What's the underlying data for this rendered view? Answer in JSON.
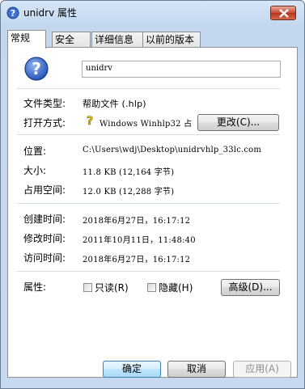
{
  "window": {
    "title": "unidrv 属性"
  },
  "tabs": [
    {
      "label": "常规"
    },
    {
      "label": "安全"
    },
    {
      "label": "详细信息"
    },
    {
      "label": "以前的版本"
    }
  ],
  "general": {
    "file_name": "unidrv",
    "file_type": {
      "label": "文件类型:",
      "value": "帮助文件 (.hlp)"
    },
    "open_with": {
      "label": "打开方式:",
      "value": "Windows Winhlp32 占",
      "change_button": "更改(C)..."
    },
    "location": {
      "label": "位置:",
      "value": "C:\\Users\\wdj\\Desktop\\unidrvhlp_33lc.com"
    },
    "size": {
      "label": "大小:",
      "value": "11.8 KB (12,164 字节)"
    },
    "size_on_disk": {
      "label": "占用空间:",
      "value": "12.0 KB (12,288 字节)"
    },
    "created": {
      "label": "创建时间:",
      "value": "2018年6月27日，16:17:12"
    },
    "modified": {
      "label": "修改时间:",
      "value": "2011年10月11日，11:48:40"
    },
    "accessed": {
      "label": "访问时间:",
      "value": "2018年6月27日，16:17:12"
    },
    "attributes": {
      "label": "属性:",
      "readonly": {
        "label": "只读(R)",
        "checked": false
      },
      "hidden": {
        "label": "隐藏(H)",
        "checked": false
      },
      "advanced_button": "高级(D)..."
    }
  },
  "footer": {
    "ok": "确定",
    "cancel": "取消",
    "apply": "应用(A)"
  }
}
